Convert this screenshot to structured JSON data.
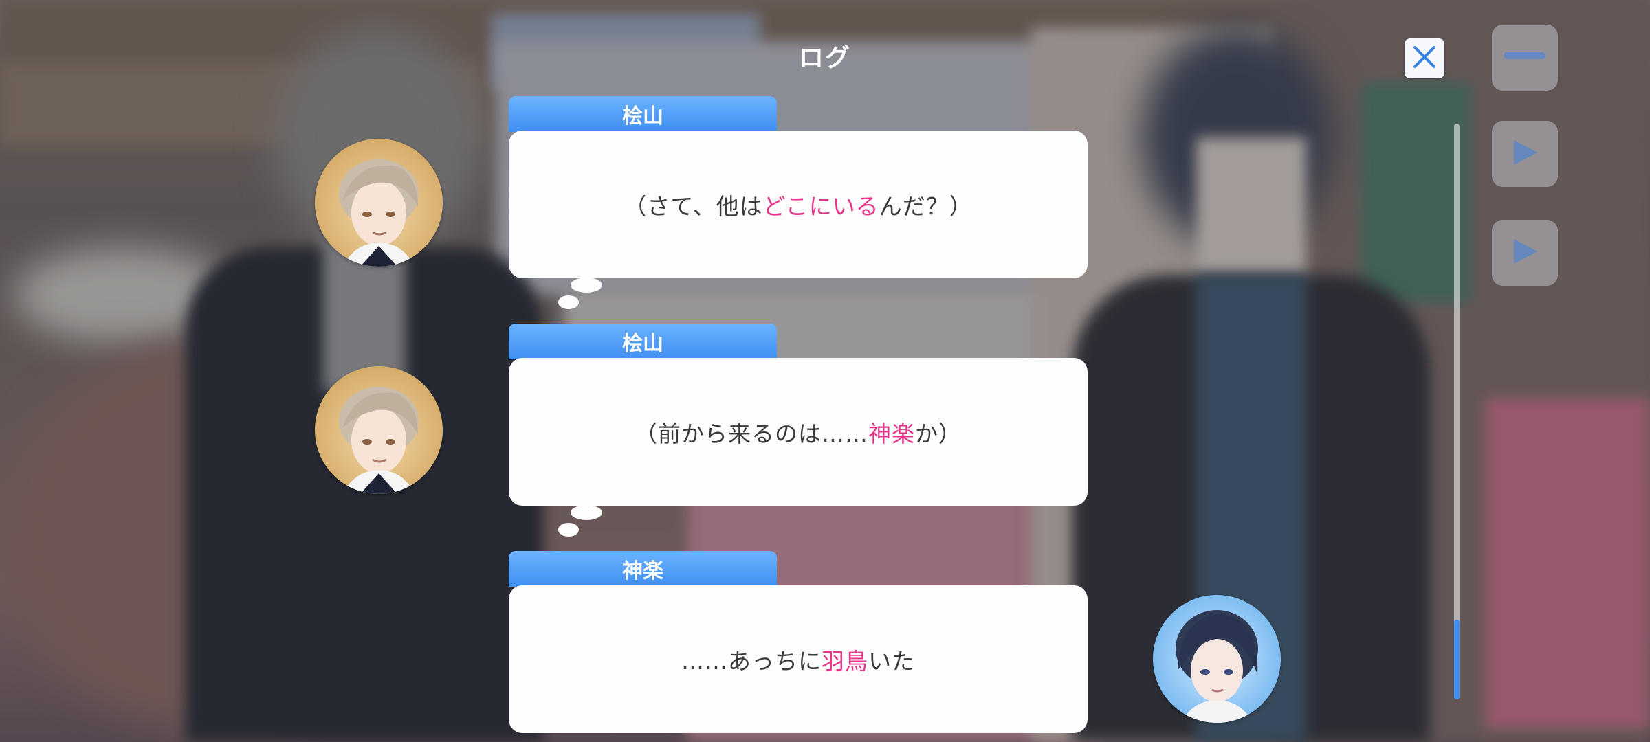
{
  "log": {
    "title": "ログ",
    "entries": [
      {
        "speaker": "桧山",
        "pre": "（さて、他は",
        "hl": "どこにいる",
        "post": "んだ？）",
        "thought": true
      },
      {
        "speaker": "桧山",
        "pre": "（前から来るのは……",
        "hl": "神楽",
        "post": "か）",
        "thought": true
      },
      {
        "speaker": "神楽",
        "pre": "……あっちに",
        "hl": "羽鳥",
        "post": "いた",
        "thought": false
      }
    ]
  },
  "icons": {
    "close": "close-icon",
    "menu": "menu-icon",
    "play": "play-icon",
    "skip": "skip-icon"
  },
  "colors": {
    "accent": "#3f8ff1",
    "highlight": "#e8338a",
    "bubble": "#fdfdfd",
    "text": "#3b3b3b"
  },
  "scroll": {
    "position": 1.0
  }
}
